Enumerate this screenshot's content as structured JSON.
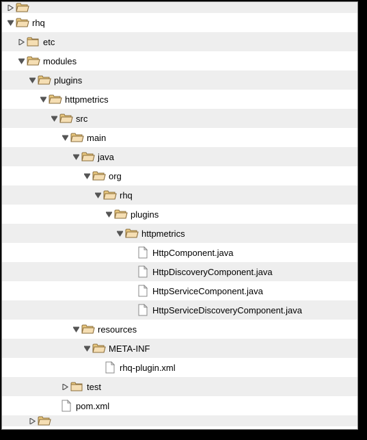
{
  "tree": [
    {
      "depth": 0,
      "expander": "right",
      "icon": "folder-open",
      "label_cut": true
    },
    {
      "depth": 0,
      "expander": "down",
      "icon": "folder-open",
      "label": "rhq"
    },
    {
      "depth": 1,
      "expander": "right",
      "icon": "folder",
      "label": "etc"
    },
    {
      "depth": 1,
      "expander": "down",
      "icon": "folder-open",
      "label": "modules"
    },
    {
      "depth": 2,
      "expander": "down",
      "icon": "folder-open",
      "label": "plugins"
    },
    {
      "depth": 3,
      "expander": "down",
      "icon": "folder-open",
      "label": "httpmetrics"
    },
    {
      "depth": 4,
      "expander": "down",
      "icon": "folder-open",
      "label": "src"
    },
    {
      "depth": 5,
      "expander": "down",
      "icon": "folder-open",
      "label": "main"
    },
    {
      "depth": 6,
      "expander": "down",
      "icon": "folder-open",
      "label": "java"
    },
    {
      "depth": 7,
      "expander": "down",
      "icon": "folder-open",
      "label": "org"
    },
    {
      "depth": 8,
      "expander": "down",
      "icon": "folder-open",
      "label": "rhq"
    },
    {
      "depth": 9,
      "expander": "down",
      "icon": "folder-open",
      "label": "plugins"
    },
    {
      "depth": 10,
      "expander": "down",
      "icon": "folder-open",
      "label": "httpmetrics"
    },
    {
      "depth": 11,
      "expander": "none",
      "icon": "file",
      "label": "HttpComponent.java"
    },
    {
      "depth": 11,
      "expander": "none",
      "icon": "file",
      "label": "HttpDiscoveryComponent.java"
    },
    {
      "depth": 11,
      "expander": "none",
      "icon": "file",
      "label": "HttpServiceComponent.java"
    },
    {
      "depth": 11,
      "expander": "none",
      "icon": "file",
      "label": "HttpServiceDiscoveryComponent.java"
    },
    {
      "depth": 6,
      "expander": "down",
      "icon": "folder-open",
      "label": "resources"
    },
    {
      "depth": 7,
      "expander": "down",
      "icon": "folder-open",
      "label": "META-INF"
    },
    {
      "depth": 8,
      "expander": "none",
      "icon": "file",
      "label": "rhq-plugin.xml"
    },
    {
      "depth": 5,
      "expander": "right",
      "icon": "folder",
      "label": "test"
    },
    {
      "depth": 4,
      "expander": "none",
      "icon": "file",
      "label": "pom.xml"
    },
    {
      "depth": 2,
      "expander": "right",
      "icon": "folder-open",
      "label_cut": true
    }
  ]
}
